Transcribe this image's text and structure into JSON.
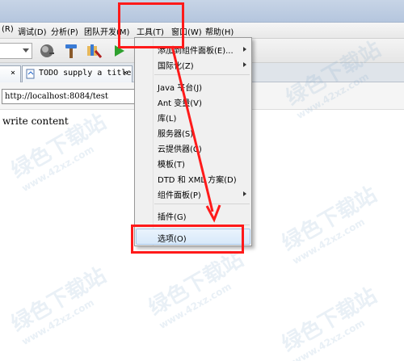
{
  "menubar": {
    "items": [
      {
        "label": "(R)"
      },
      {
        "label": "调试(D)"
      },
      {
        "label": "分析(P)"
      },
      {
        "label": "团队开发(M)"
      },
      {
        "label": "工具(T)"
      },
      {
        "label": "窗口(W)"
      },
      {
        "label": "帮助(H)"
      }
    ]
  },
  "tabs": {
    "close_glyph": "×",
    "active": {
      "label": "TODO supply a title"
    }
  },
  "urlbar": {
    "value": "http://localhost:8084/test"
  },
  "content": {
    "text": "write content"
  },
  "tools_menu": {
    "items": [
      {
        "label": "添加到组件面板(E)..."
      },
      {
        "label": "国际化(Z)"
      },
      {
        "label": "Java 平台(J)"
      },
      {
        "label": "Ant 变量(V)"
      },
      {
        "label": "库(L)"
      },
      {
        "label": "服务器(S)"
      },
      {
        "label": "云提供器(C)"
      },
      {
        "label": "模板(T)"
      },
      {
        "label": "DTD 和 XML 方案(D)"
      },
      {
        "label": "组件面板(P)"
      },
      {
        "label": "插件(G)"
      },
      {
        "label": "选项(O)"
      }
    ]
  },
  "watermark": {
    "text": "绿色下载站",
    "url": "www.42xz.com"
  },
  "colors": {
    "annotation": "#ff1a1a",
    "highlight_border": "#a8c8eb"
  }
}
